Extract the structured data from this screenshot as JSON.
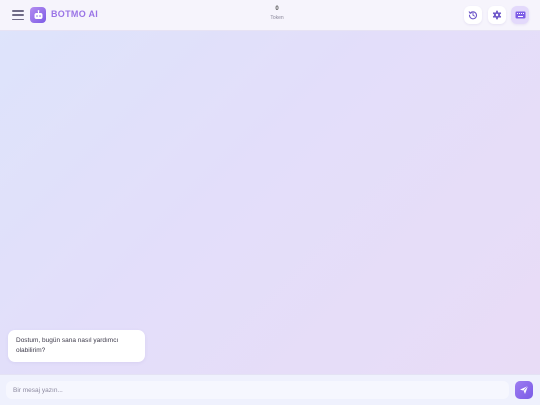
{
  "header": {
    "brand": "BOTMO AI",
    "token": {
      "count": "0",
      "label": "Token"
    },
    "icons": {
      "menu": "hamburger-menu-icon",
      "logo": "robot-icon",
      "history": "history-icon",
      "settings": "gear-icon",
      "keyboard": "keyboard-icon"
    }
  },
  "chat": {
    "messages": [
      {
        "sender": "bot",
        "text": "Dostum, bugün sana nasıl yardımcı olabilirim?"
      }
    ]
  },
  "composer": {
    "placeholder": "Bir mesaj yazın...",
    "value": "",
    "send_icon": "send-icon"
  },
  "colors": {
    "accent": "#8b68ea",
    "brand_text": "#9a74e6",
    "header_bg": "#f6f4fc",
    "bubble_bg": "#ffffff"
  }
}
